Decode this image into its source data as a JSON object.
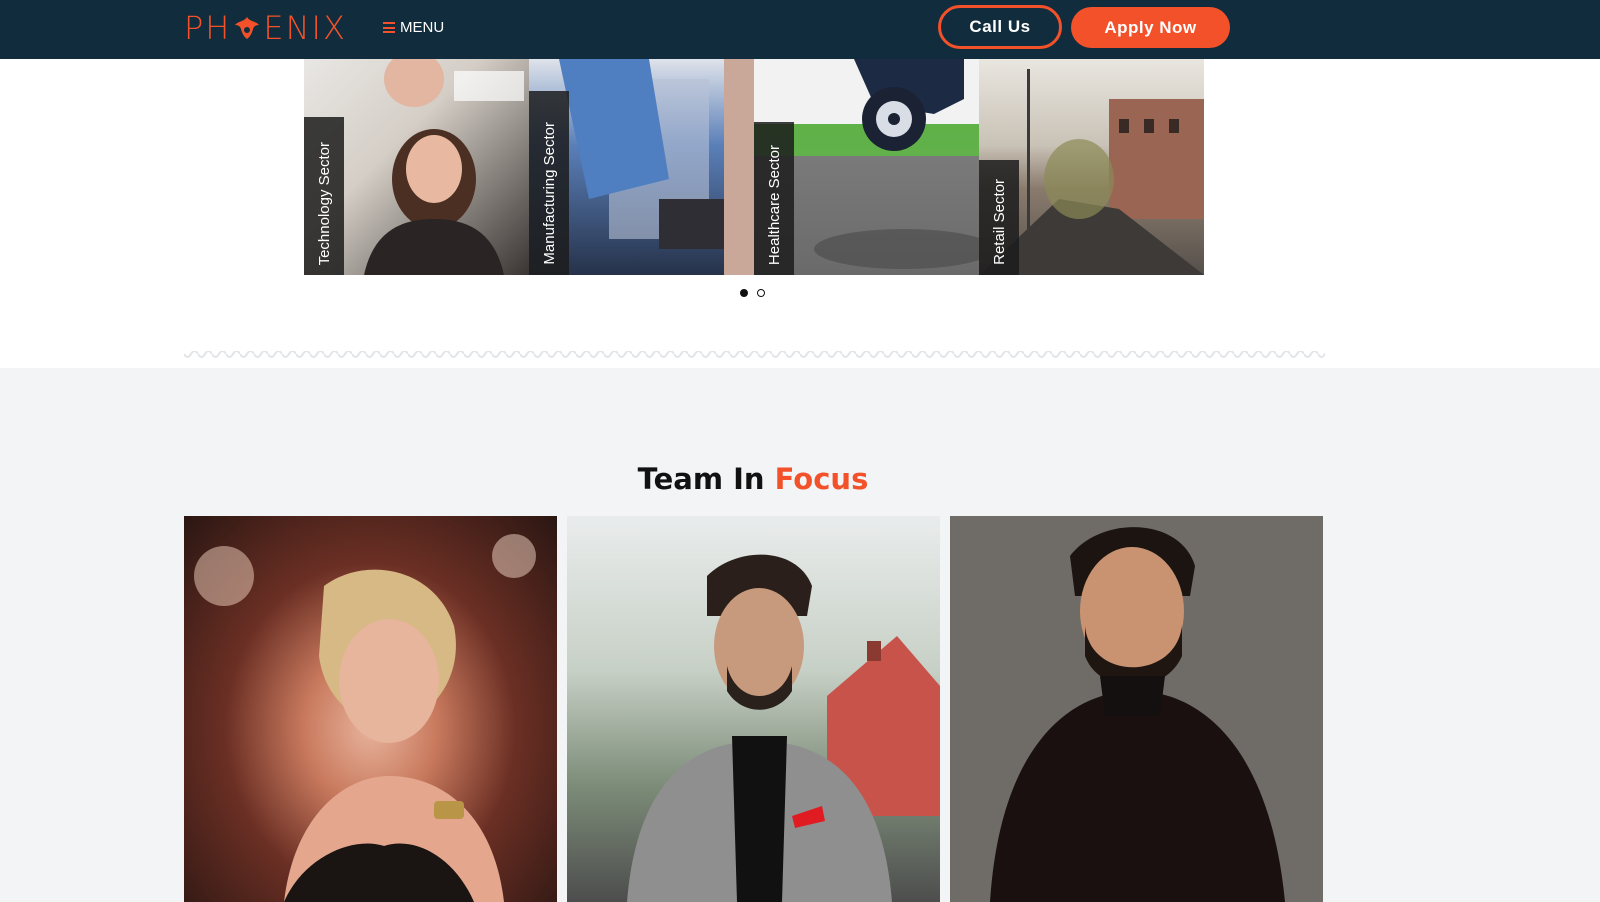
{
  "header": {
    "logo_text": "PH ENIX",
    "menu_label": "MENU",
    "call_label": "Call Us",
    "apply_label": "Apply Now"
  },
  "slider": {
    "slides": [
      {
        "label": "Technology Sector"
      },
      {
        "label": "Manufacturing Sector"
      },
      {
        "label": "Healthcare Sector"
      },
      {
        "label": "Retail Sector"
      }
    ],
    "pages": 2,
    "active_page": 1
  },
  "team": {
    "title_part1": "Team In ",
    "title_part2": "Focus"
  },
  "colors": {
    "brand_orange": "#f2512a",
    "header_navy": "#112d3d",
    "section_bg": "#f3f4f6"
  }
}
